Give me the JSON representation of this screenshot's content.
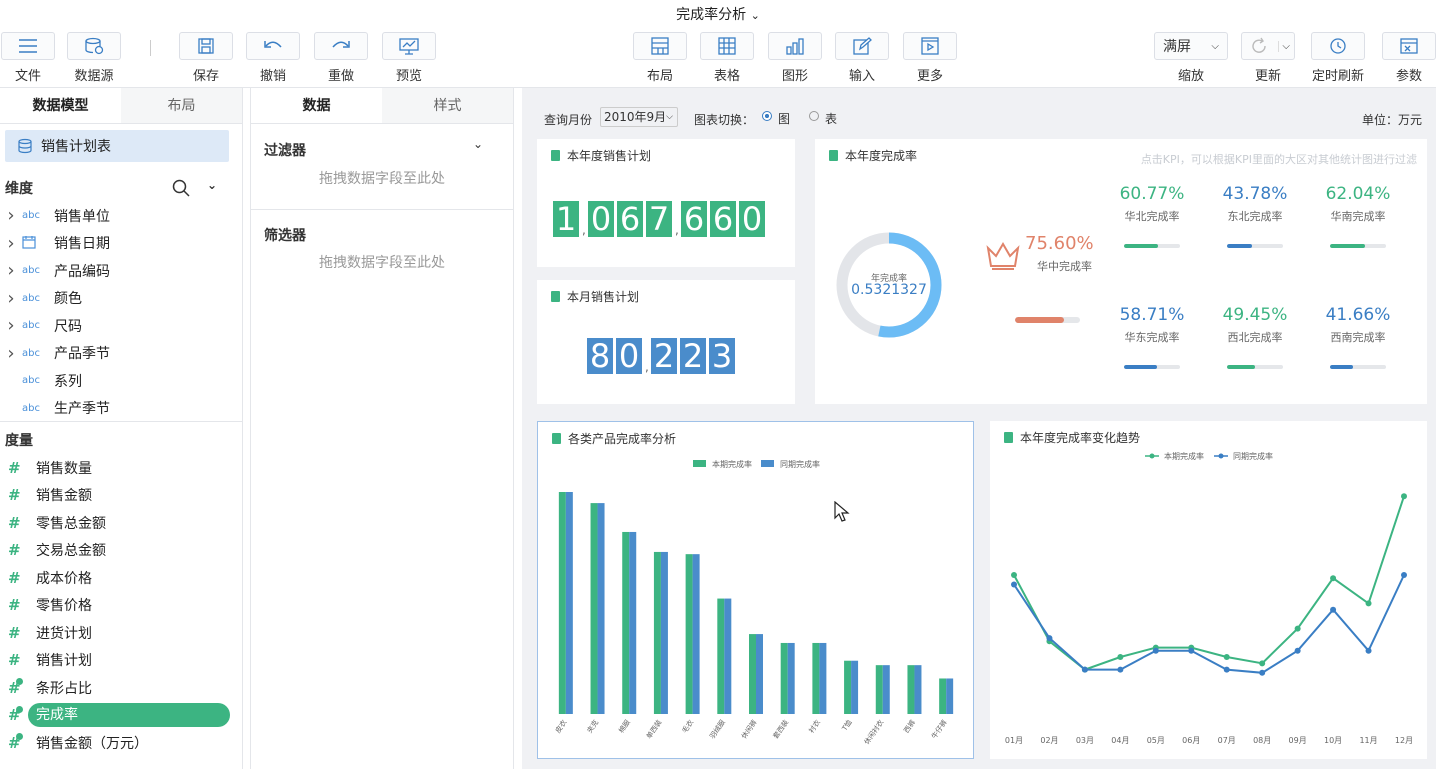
{
  "window": {
    "title": "完成率分析"
  },
  "toolbar": {
    "file": "文件",
    "datasource": "数据源",
    "save": "保存",
    "undo": "撤销",
    "redo": "重做",
    "preview": "预览",
    "layout": "布局",
    "table": "表格",
    "chart": "图形",
    "input": "输入",
    "more": "更多",
    "zoom_value": "满屏",
    "zoom": "缩放",
    "refresh": "更新",
    "timer_refresh": "定时刷新",
    "params": "参数"
  },
  "left": {
    "tabs": [
      "数据模型",
      "布局"
    ],
    "table_name": "销售计划表",
    "dim_title": "维度",
    "dims": [
      {
        "label": "销售单位",
        "type": "abc",
        "expand": true
      },
      {
        "label": "销售日期",
        "type": "date",
        "expand": true
      },
      {
        "label": "产品编码",
        "type": "abc",
        "expand": true
      },
      {
        "label": "颜色",
        "type": "abc",
        "expand": true
      },
      {
        "label": "尺码",
        "type": "abc",
        "expand": true
      },
      {
        "label": "产品季节",
        "type": "abc",
        "expand": true
      },
      {
        "label": "系列",
        "type": "abc",
        "expand": false
      },
      {
        "label": "生产季节",
        "type": "abc",
        "expand": false
      }
    ],
    "measure_title": "度量",
    "measures": [
      "销售数量",
      "销售金额",
      "零售总金额",
      "交易总金额",
      "成本价格",
      "零售价格",
      "进货计划",
      "销售计划",
      "条形占比",
      "完成率",
      "销售金额（万元）"
    ]
  },
  "mid": {
    "tabs": [
      "数据",
      "样式"
    ],
    "filter_title": "过滤器",
    "filter_hint": "拖拽数据字段至此处",
    "selector_title": "筛选器",
    "selector_hint": "拖拽数据字段至此处"
  },
  "dashboard": {
    "query_label": "查询月份",
    "query_value": "2010年9月",
    "switch_label": "图表切换：",
    "opt_chart": "图",
    "opt_table": "表",
    "unit": "单位：万元",
    "year_plan": {
      "title": "本年度销售计划",
      "value": "1,067,660",
      "color": "#3cb482"
    },
    "month_plan": {
      "title": "本月销售计划",
      "value": "80,223",
      "color": "#4a8ccb"
    },
    "completion": {
      "title": "本年度完成率",
      "hint": "点击KPI，可以根据KPI里面的大区对其他统计图进行过滤",
      "gauge_label": "年完成率",
      "gauge_value": "0.5321327",
      "gauge_fraction": 0.5321327,
      "center_kpi": {
        "value": "75.60%",
        "name": "华中完成率",
        "fraction": 0.756,
        "color": "#e0836a"
      },
      "kpis": [
        {
          "value": "60.77%",
          "name": "华北完成率",
          "fraction": 0.6077,
          "color": "#3cb482"
        },
        {
          "value": "43.78%",
          "name": "东北完成率",
          "fraction": 0.4378,
          "color": "#3a7ec4"
        },
        {
          "value": "62.04%",
          "name": "华南完成率",
          "fraction": 0.6204,
          "color": "#3cb482"
        },
        {
          "value": "58.71%",
          "name": "华东完成率",
          "fraction": 0.5871,
          "color": "#3a7ec4"
        },
        {
          "value": "49.45%",
          "name": "西北完成率",
          "fraction": 0.4945,
          "color": "#3cb482"
        },
        {
          "value": "41.66%",
          "name": "西南完成率",
          "fraction": 0.4166,
          "color": "#3a7ec4"
        }
      ]
    },
    "bar_title": "各类产品完成率分析",
    "line_title": "本年度完成率变化趋势"
  },
  "chart_data": [
    {
      "type": "bar",
      "title": "各类产品完成率分析",
      "categories": [
        "皮衣",
        "夹克",
        "棉服",
        "单西装",
        "毛衣",
        "羽绒服",
        "休闲裤",
        "套西装",
        "衬衣",
        "T恤",
        "休闲衬衣",
        "西裤",
        "牛仔裤"
      ],
      "series": [
        {
          "name": "本期完成率",
          "color": "#3cb482",
          "values": [
            1.0,
            0.95,
            0.82,
            0.73,
            0.72,
            0.52,
            0.36,
            0.32,
            0.32,
            0.24,
            0.22,
            0.22,
            0.16
          ]
        },
        {
          "name": "同期完成率",
          "color": "#4a8ccb",
          "values": [
            1.0,
            0.95,
            0.82,
            0.73,
            0.72,
            0.52,
            0.36,
            0.32,
            0.32,
            0.24,
            0.22,
            0.22,
            0.16
          ]
        }
      ],
      "ylim": [
        0,
        1.0
      ],
      "legend": "top-center"
    },
    {
      "type": "line",
      "title": "本年度完成率变化趋势",
      "categories": [
        "01月",
        "02月",
        "03月",
        "04月",
        "05月",
        "06月",
        "07月",
        "08月",
        "09月",
        "10月",
        "11月",
        "12月"
      ],
      "series": [
        {
          "name": "本期完成率",
          "color": "#3cb482",
          "values": [
            0.52,
            0.31,
            0.22,
            0.26,
            0.29,
            0.29,
            0.26,
            0.24,
            0.35,
            0.51,
            0.43,
            0.77
          ]
        },
        {
          "name": "同期完成率",
          "color": "#3a7ec4",
          "values": [
            0.49,
            0.32,
            0.22,
            0.22,
            0.28,
            0.28,
            0.22,
            0.21,
            0.28,
            0.41,
            0.28,
            0.52
          ]
        }
      ],
      "ylim": [
        0,
        0.85
      ],
      "legend": "top-center"
    }
  ]
}
